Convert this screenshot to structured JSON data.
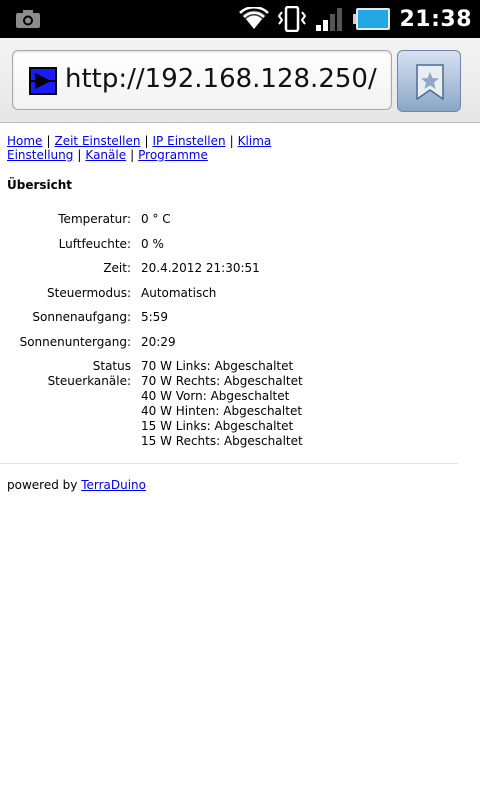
{
  "status_bar": {
    "time": "21:38",
    "icons": [
      "camera-icon",
      "wifi-icon",
      "vibrate-icon",
      "signal-icon",
      "battery-icon"
    ],
    "battery_color": "#22a7e4"
  },
  "browser": {
    "url": "http://192.168.128.250/"
  },
  "nav": {
    "links": [
      "Home",
      "Zeit Einstellen",
      "IP Einstellen",
      "Klima Einstellung",
      "Kanäle",
      "Programme"
    ],
    "separator": "|"
  },
  "page": {
    "heading": "Übersicht",
    "rows": [
      {
        "label": "Temperatur:",
        "value": "0 ° C"
      },
      {
        "label": "Luftfeuchte:",
        "value": "0 %"
      },
      {
        "label": "Zeit:",
        "value": "20.4.2012 21:30:51"
      },
      {
        "label": "Steuermodus:",
        "value": "Automatisch"
      },
      {
        "label": "Sonnenaufgang:",
        "value": "5:59"
      },
      {
        "label": "Sonnenuntergang:",
        "value": "20:29"
      }
    ],
    "channels_label": "Status Steuerkanäle:",
    "channels": [
      "70 W Links: Abgeschaltet",
      "70 W Rechts: Abgeschaltet",
      "40 W Vorn: Abgeschaltet",
      "40 W Hinten: Abgeschaltet",
      "15 W Links: Abgeschaltet",
      "15 W Rechts: Abgeschaltet"
    ]
  },
  "footer": {
    "text": "powered by",
    "link": "TerraDuino"
  }
}
